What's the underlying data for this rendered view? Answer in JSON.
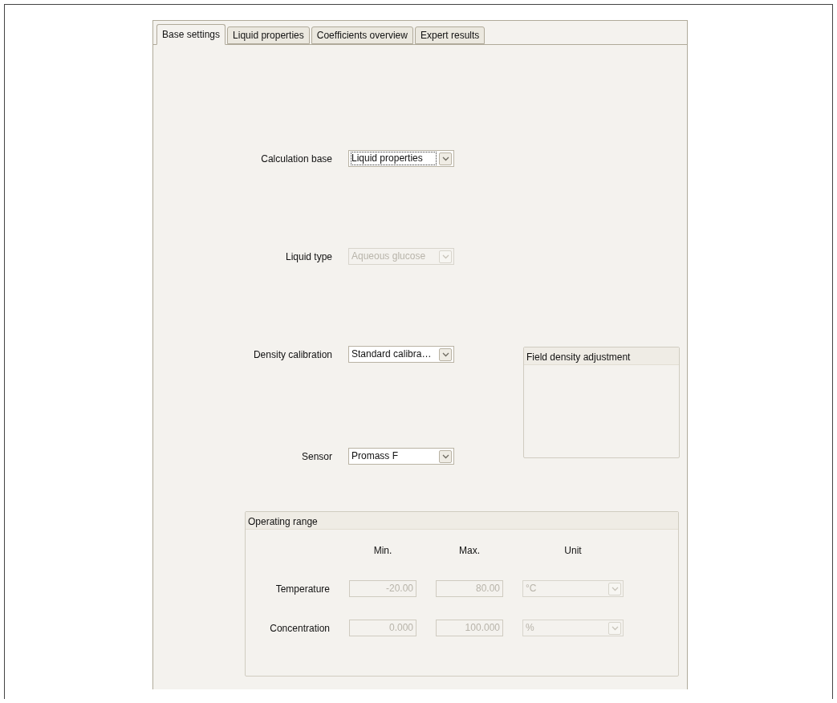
{
  "tabs": [
    {
      "label": "Base settings",
      "selected": true
    },
    {
      "label": "Liquid properties",
      "selected": false
    },
    {
      "label": "Coefficients overview",
      "selected": false
    },
    {
      "label": "Expert results",
      "selected": false
    }
  ],
  "settings": [
    {
      "label": "Calculation base",
      "value": "Liquid properties",
      "disabled": false,
      "focused": true
    },
    {
      "label": "Liquid type",
      "value": "Aqueous glucose",
      "disabled": true,
      "focused": false
    },
    {
      "label": "Density calibration",
      "value": "Standard calibra…",
      "disabled": false,
      "focused": false
    },
    {
      "label": "Sensor",
      "value": "Promass F",
      "disabled": false,
      "focused": false
    }
  ],
  "field_density_adjustment": {
    "title": "Field density adjustment"
  },
  "operating_range": {
    "title": "Operating range",
    "columns": [
      "Min.",
      "Max.",
      "Unit"
    ],
    "rows": [
      {
        "label": "Temperature",
        "min": "-20.00",
        "max": "80.00",
        "unit": "°C",
        "disabled": true
      },
      {
        "label": "Concentration",
        "min": "0.000",
        "max": "100.000",
        "unit": "%",
        "disabled": true
      }
    ]
  }
}
